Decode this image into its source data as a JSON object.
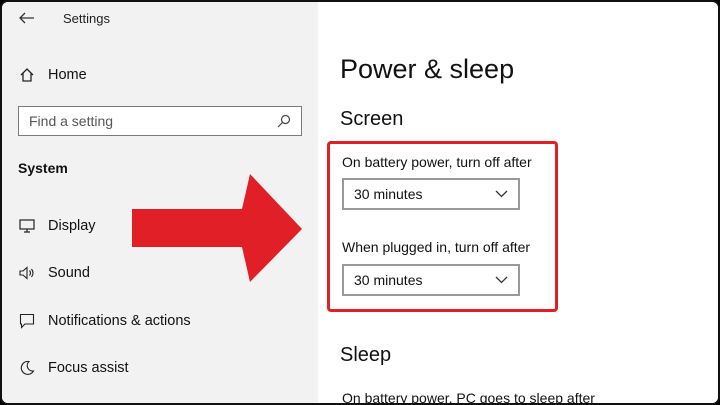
{
  "window": {
    "title": "Settings"
  },
  "sidebar": {
    "home_label": "Home",
    "search_placeholder": "Find a setting",
    "section_label": "System",
    "items": [
      {
        "label": "Display",
        "icon": "monitor-icon"
      },
      {
        "label": "Sound",
        "icon": "speaker-icon"
      },
      {
        "label": "Notifications & actions",
        "icon": "notification-icon"
      },
      {
        "label": "Focus assist",
        "icon": "moon-icon"
      }
    ]
  },
  "main": {
    "title": "Power & sleep",
    "screen_heading": "Screen",
    "battery_label": "On battery power, turn off after",
    "battery_value": "30 minutes",
    "plugged_label": "When plugged in, turn off after",
    "plugged_value": "30 minutes",
    "sleep_heading": "Sleep",
    "sleep_battery_label": "On battery power, PC goes to sleep after"
  },
  "annotation": {
    "color": "#e01f26"
  }
}
